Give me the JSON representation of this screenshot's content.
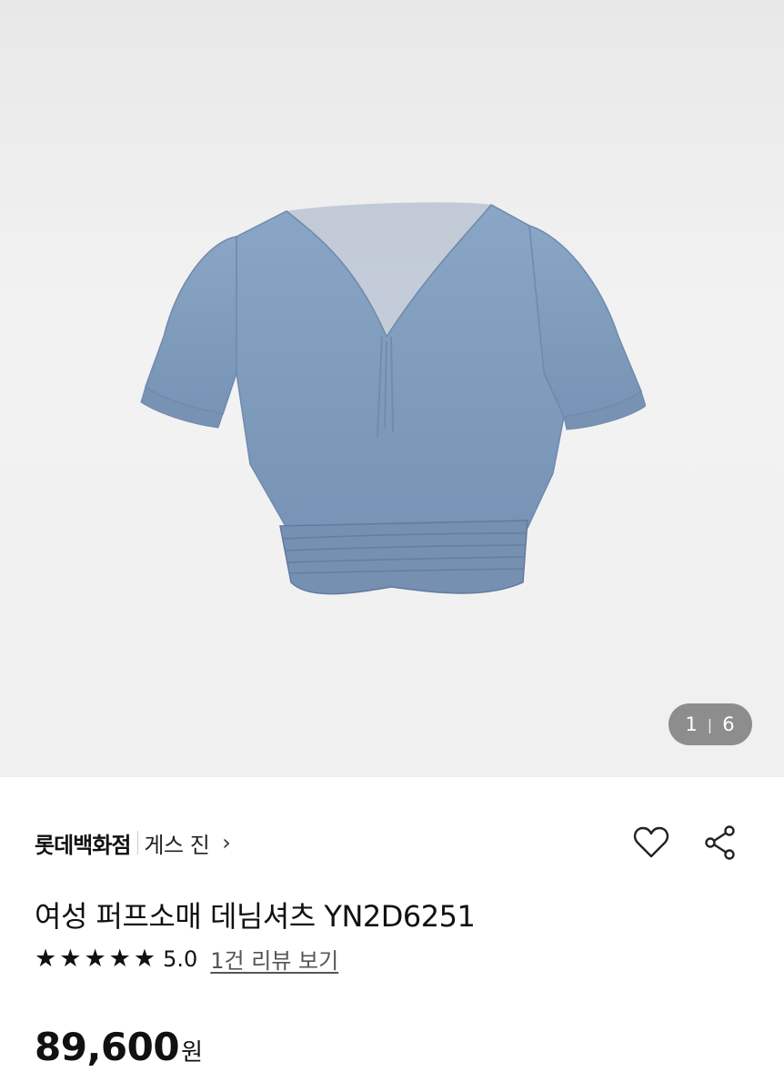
{
  "gallery": {
    "image_alt": "denim puff sleeve crop shirt",
    "counter_current": "1",
    "counter_separator": "|",
    "counter_total": "6"
  },
  "product": {
    "seller": "롯데백화점",
    "brand": "게스 진",
    "brand_chevron": "›",
    "title": "여성 퍼프소매 데님셔츠 YN2D6251",
    "stars": [
      "★",
      "★",
      "★",
      "★",
      "★"
    ],
    "rating": "5.0",
    "review_link": "1건 리뷰 보기",
    "price": "89,600",
    "currency": "원"
  },
  "icons": {
    "wishlist": "heart-outline-icon",
    "share": "share-icon"
  },
  "colors": {
    "denim": "#7f9dbf",
    "counter_bg": "#8d8d8d"
  }
}
